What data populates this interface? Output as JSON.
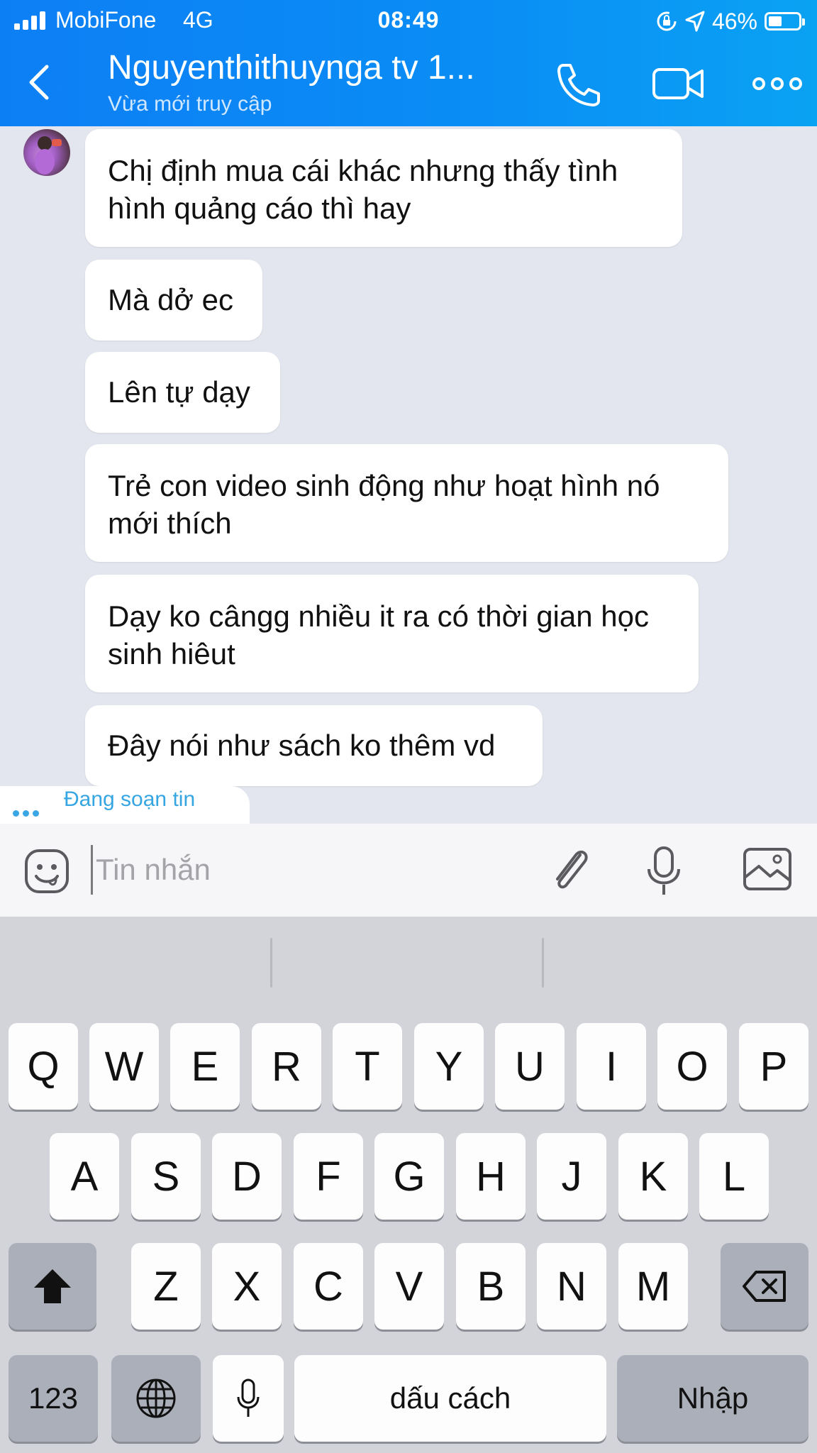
{
  "status_bar": {
    "carrier": "MobiFone",
    "network": "4G",
    "time": "08:49",
    "battery_percent": "46%",
    "battery_level": 0.46
  },
  "header": {
    "contact_name": "Nguyenthithuynga tv 1...",
    "contact_status": "Vừa mới truy cập",
    "icons": [
      "back-arrow-icon",
      "phone-icon",
      "video-camera-icon",
      "more-icon"
    ]
  },
  "messages": [
    {
      "lines": [
        "Chị định mua cái khác nhưng thấy tình",
        "hình quảng cáo thì hay"
      ]
    },
    {
      "lines": [
        "Mà dở ec"
      ]
    },
    {
      "lines": [
        "Lên tự dạy"
      ]
    },
    {
      "lines": [
        "Trẻ con video sinh động như hoạt hình nó",
        "mới thích"
      ]
    },
    {
      "lines": [
        "Dạy ko cângg nhiều it ra có thời gian học",
        "sinh hiêut"
      ]
    },
    {
      "lines": [
        "Đây nói như sách ko thêm vd"
      ]
    }
  ],
  "typing_indicator": "Đang soạn tin",
  "composer": {
    "placeholder": "Tin nhắn",
    "icons": [
      "emoji-icon",
      "paperclip-icon",
      "microphone-icon",
      "image-icon"
    ]
  },
  "keyboard": {
    "row1": [
      "Q",
      "W",
      "E",
      "R",
      "T",
      "Y",
      "U",
      "I",
      "O",
      "P"
    ],
    "row2": [
      "A",
      "S",
      "D",
      "F",
      "G",
      "H",
      "J",
      "K",
      "L"
    ],
    "row3": [
      "Z",
      "X",
      "C",
      "V",
      "B",
      "N",
      "M"
    ],
    "numbers_key": "123",
    "space_key": "dấu cách",
    "return_key": "Nhập"
  },
  "colors": {
    "header_blue": "#0d7ff5",
    "chat_bg": "#e3e6ee",
    "typing_blue": "#36a6e2",
    "keyboard_bg": "#d2d4da"
  }
}
